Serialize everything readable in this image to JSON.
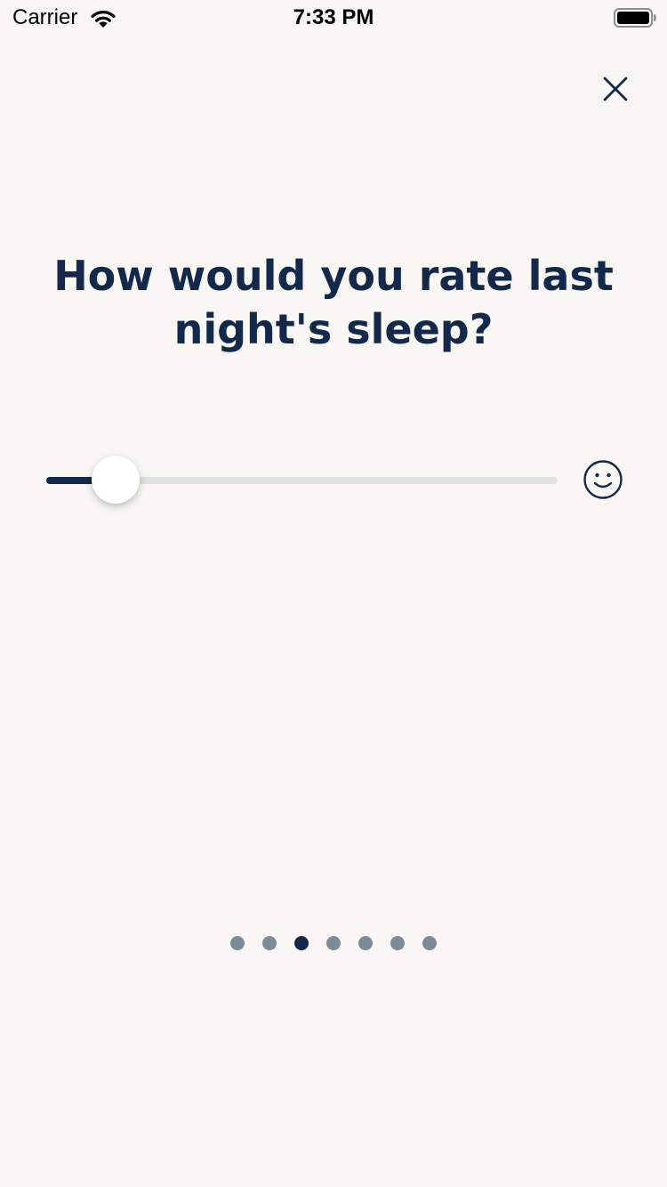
{
  "status_bar": {
    "carrier": "Carrier",
    "time": "7:33 PM",
    "wifi_icon": "wifi-icon",
    "battery_icon": "battery-icon"
  },
  "header": {
    "close_icon": "close-icon"
  },
  "question": {
    "title": "How would you rate last night's sleep?"
  },
  "rating_slider": {
    "value_fraction": 0.135,
    "end_icon": "smiley-face-icon"
  },
  "pager": {
    "total_pages": 7,
    "current_page": 3
  },
  "colors": {
    "background": "#f8f7f3",
    "primary": "#13294b",
    "track": "#e0e0e0",
    "dot_inactive": "#7d8a98"
  }
}
